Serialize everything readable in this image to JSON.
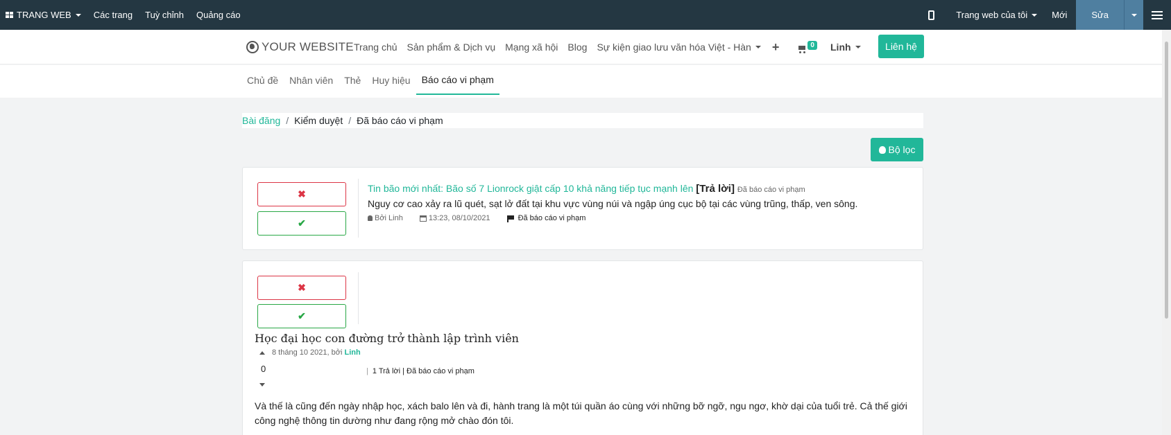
{
  "adminbar": {
    "brand": "TRANG WEB",
    "items": [
      "Các trang",
      "Tuỳ chỉnh",
      "Quảng cáo"
    ],
    "my_website": "Trang web của tôi",
    "new": "Mới",
    "edit": "Sửa"
  },
  "header": {
    "logo": "YOUR WEBSITE",
    "nav": [
      "Trang chủ",
      "Sản phẩm & Dịch vụ",
      "Mạng xã hội",
      "Blog",
      "Sự kiện giao lưu văn hóa Việt - Hàn"
    ],
    "cart_count": "0",
    "user": "Linh",
    "contact": "Liên hệ"
  },
  "subnav": {
    "tabs": [
      "Chủ đề",
      "Nhân viên",
      "Thẻ",
      "Huy hiệu",
      "Báo cáo vi phạm"
    ]
  },
  "breadcrumb": {
    "items": [
      "Bài đăng",
      "Kiểm duyệt",
      "Đã báo cáo vi phạm"
    ]
  },
  "filter_label": "Bộ lọc",
  "reject_symbol": "✖",
  "accept_symbol": "✔",
  "post1": {
    "title": "Tin bão mới nhất: Bão số 7 Lionrock giật cấp 10 khả năng tiếp tục mạnh lên",
    "reply_tag": "[Trả lời]",
    "status": "Đã báo cáo vi phạm",
    "body": "Nguy cơ cao xảy ra lũ quét, sạt lở đất tại khu vực vùng núi và ngập úng cục bộ tại các vùng trũng, thấp, ven sông.",
    "author": "Bởi Linh",
    "datetime": "13:23, 08/10/2021",
    "flag": "Đã báo cáo vi phạm"
  },
  "post2": {
    "title": "Học đại học con đường trở thành lập trình viên",
    "meta_date": "8 tháng 10 2021, bởi",
    "meta_author": "Linh",
    "votes": "0",
    "stats": "1 Trả lời | Đã báo cáo vi phạm",
    "body": "Và thế là cũng đến ngày nhập học, xách balo lên và đi, hành trang là một túi quần áo cùng với những bỡ ngỡ, ngu ngơ, khờ dại của tuổi trẻ. Cả thế giới công nghệ thông tin dường như đang rộng mở chào đón tôi."
  }
}
